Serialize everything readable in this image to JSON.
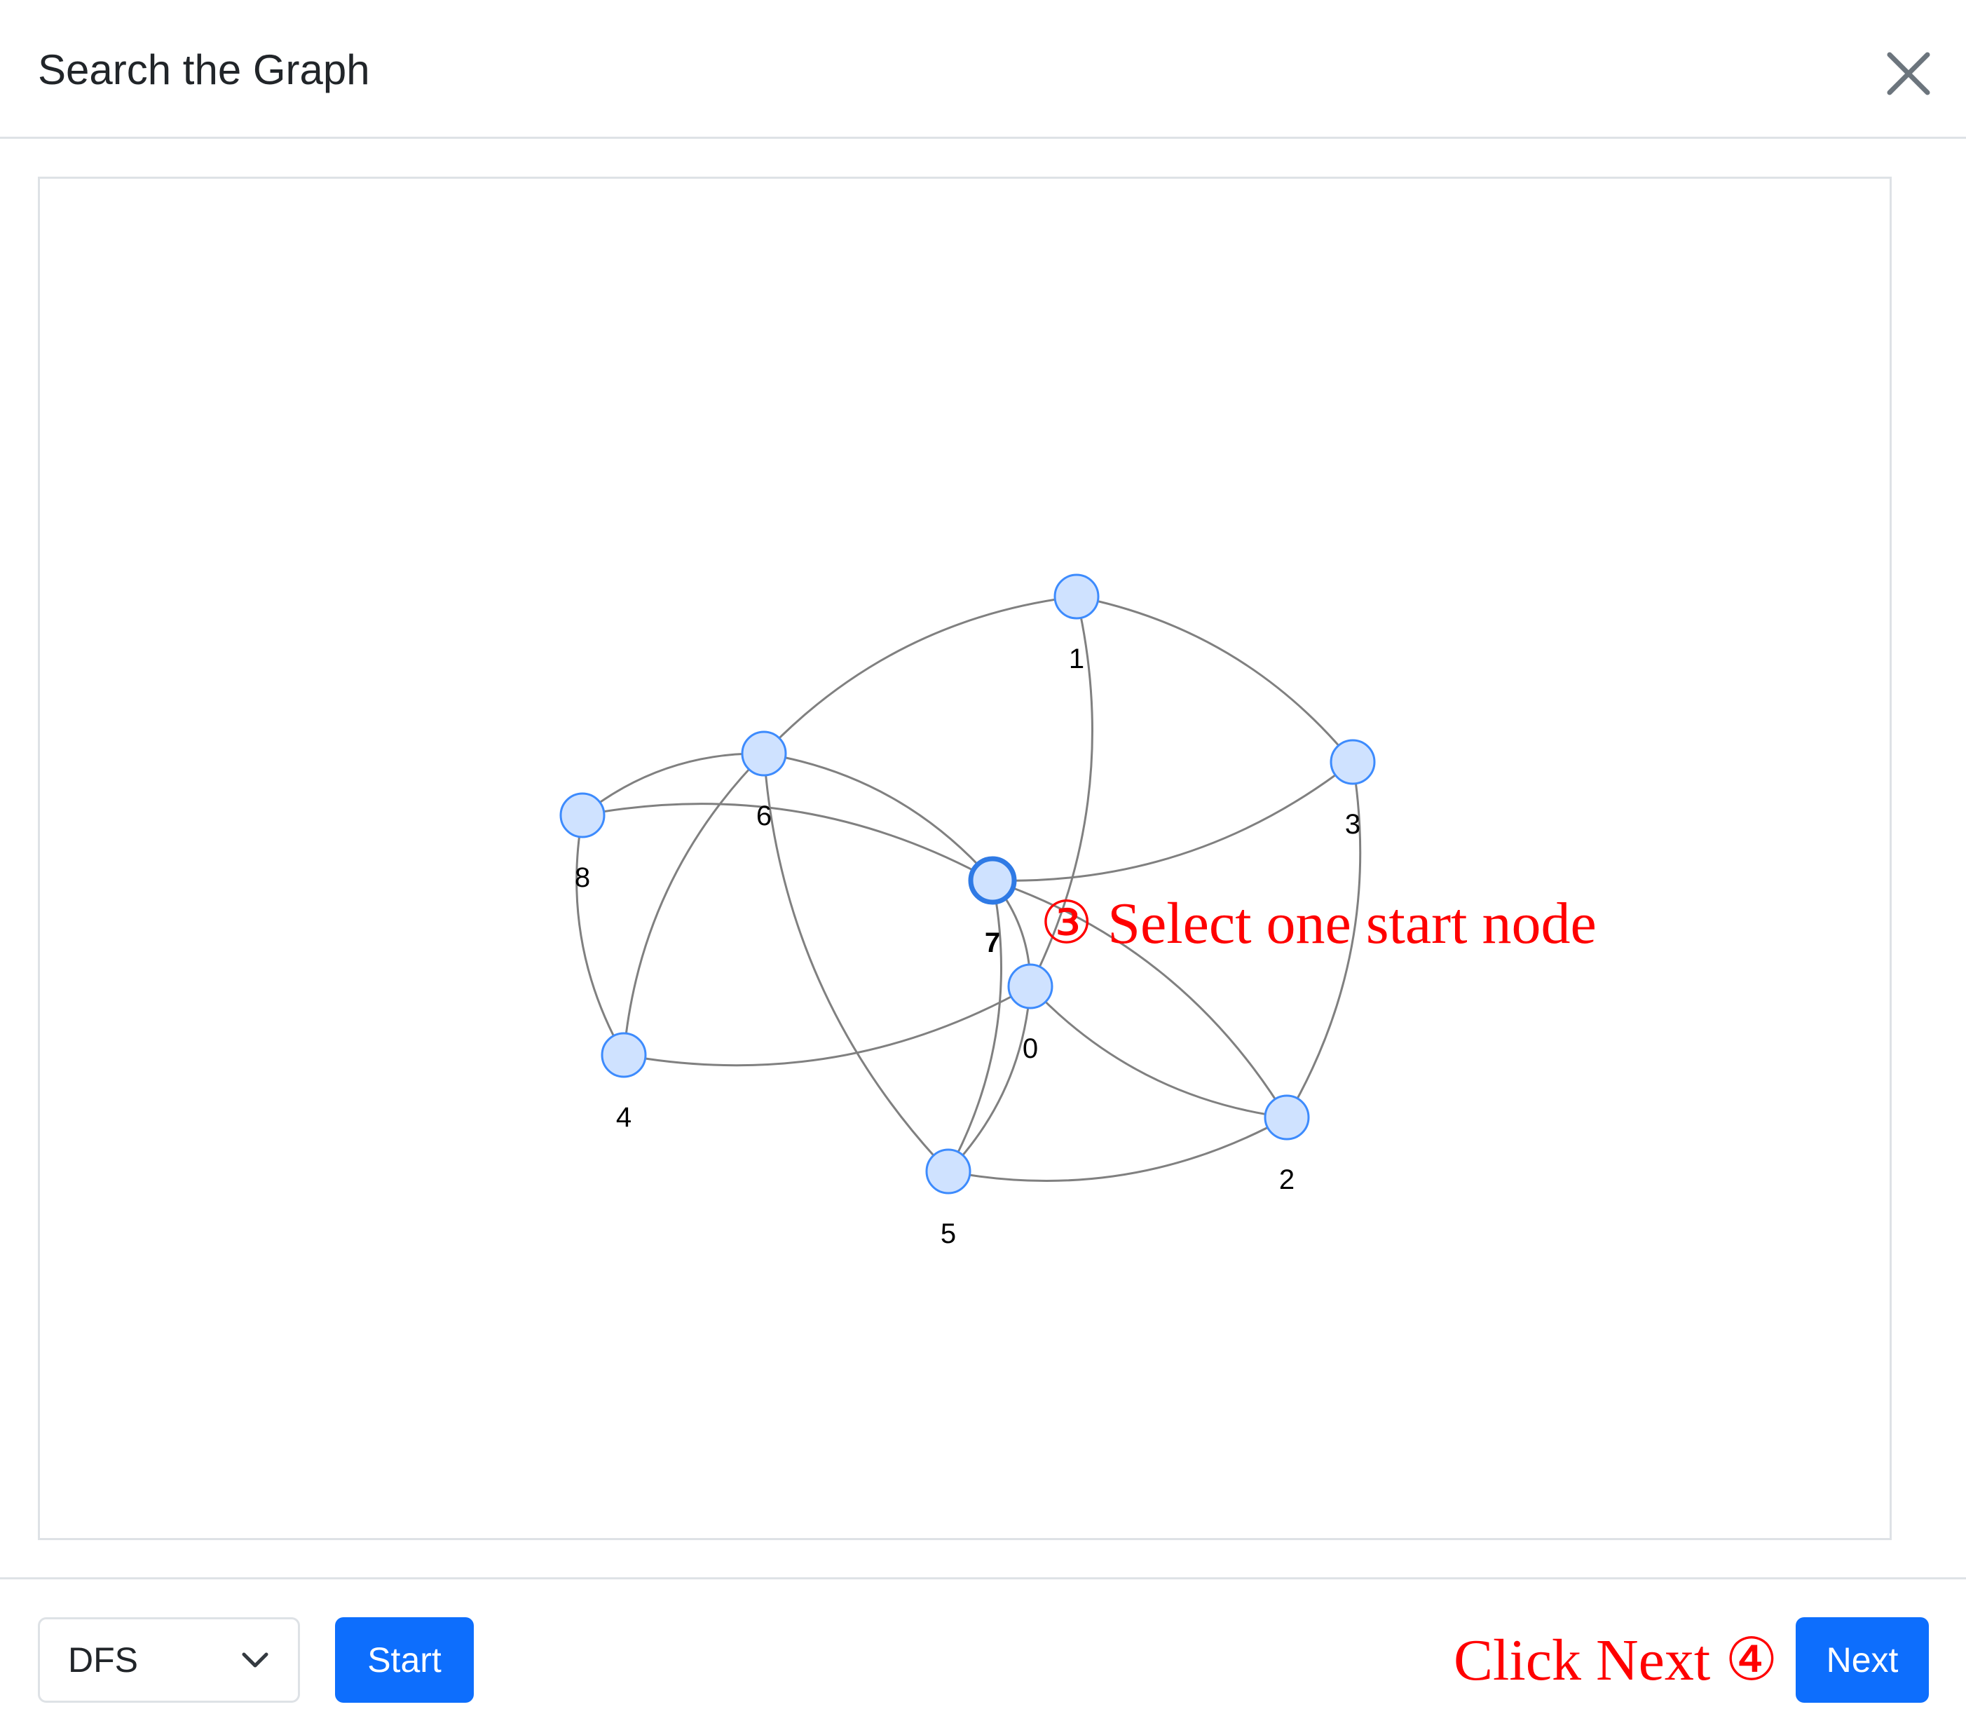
{
  "dialog": {
    "title": "Search the Graph",
    "close_icon": "close-icon"
  },
  "graph": {
    "nodes": [
      {
        "id": "0",
        "label": "0",
        "selected": false
      },
      {
        "id": "1",
        "label": "1",
        "selected": false
      },
      {
        "id": "2",
        "label": "2",
        "selected": false
      },
      {
        "id": "3",
        "label": "3",
        "selected": false
      },
      {
        "id": "4",
        "label": "4",
        "selected": false
      },
      {
        "id": "5",
        "label": "5",
        "selected": false
      },
      {
        "id": "6",
        "label": "6",
        "selected": false
      },
      {
        "id": "7",
        "label": "7",
        "selected": true
      },
      {
        "id": "8",
        "label": "8",
        "selected": false
      }
    ],
    "edges": [
      [
        "6",
        "1"
      ],
      [
        "1",
        "3"
      ],
      [
        "1",
        "0"
      ],
      [
        "3",
        "7"
      ],
      [
        "3",
        "2"
      ],
      [
        "8",
        "6"
      ],
      [
        "8",
        "4"
      ],
      [
        "8",
        "7"
      ],
      [
        "6",
        "7"
      ],
      [
        "6",
        "4"
      ],
      [
        "6",
        "5"
      ],
      [
        "7",
        "5"
      ],
      [
        "7",
        "0"
      ],
      [
        "7",
        "2"
      ],
      [
        "0",
        "4"
      ],
      [
        "0",
        "5"
      ],
      [
        "0",
        "2"
      ],
      [
        "5",
        "2"
      ]
    ],
    "colors": {
      "node_fill": "#cfe2ff",
      "node_stroke": "#3d8bfd",
      "selected_stroke": "#2f7ae5",
      "edge": "#808080",
      "label": "#000000"
    }
  },
  "footer": {
    "algorithm_value": "DFS",
    "algorithm_chevron_icon": "chevron-down-icon",
    "start_label": "Start",
    "next_label": "Next"
  },
  "annotations": {
    "select_node": "③ Select one start node",
    "click_next": "Click Next ④",
    "color": "#ff0000"
  },
  "colors": {
    "primary": "#0d6efd",
    "border": "#dee2e6",
    "text": "#212529"
  }
}
